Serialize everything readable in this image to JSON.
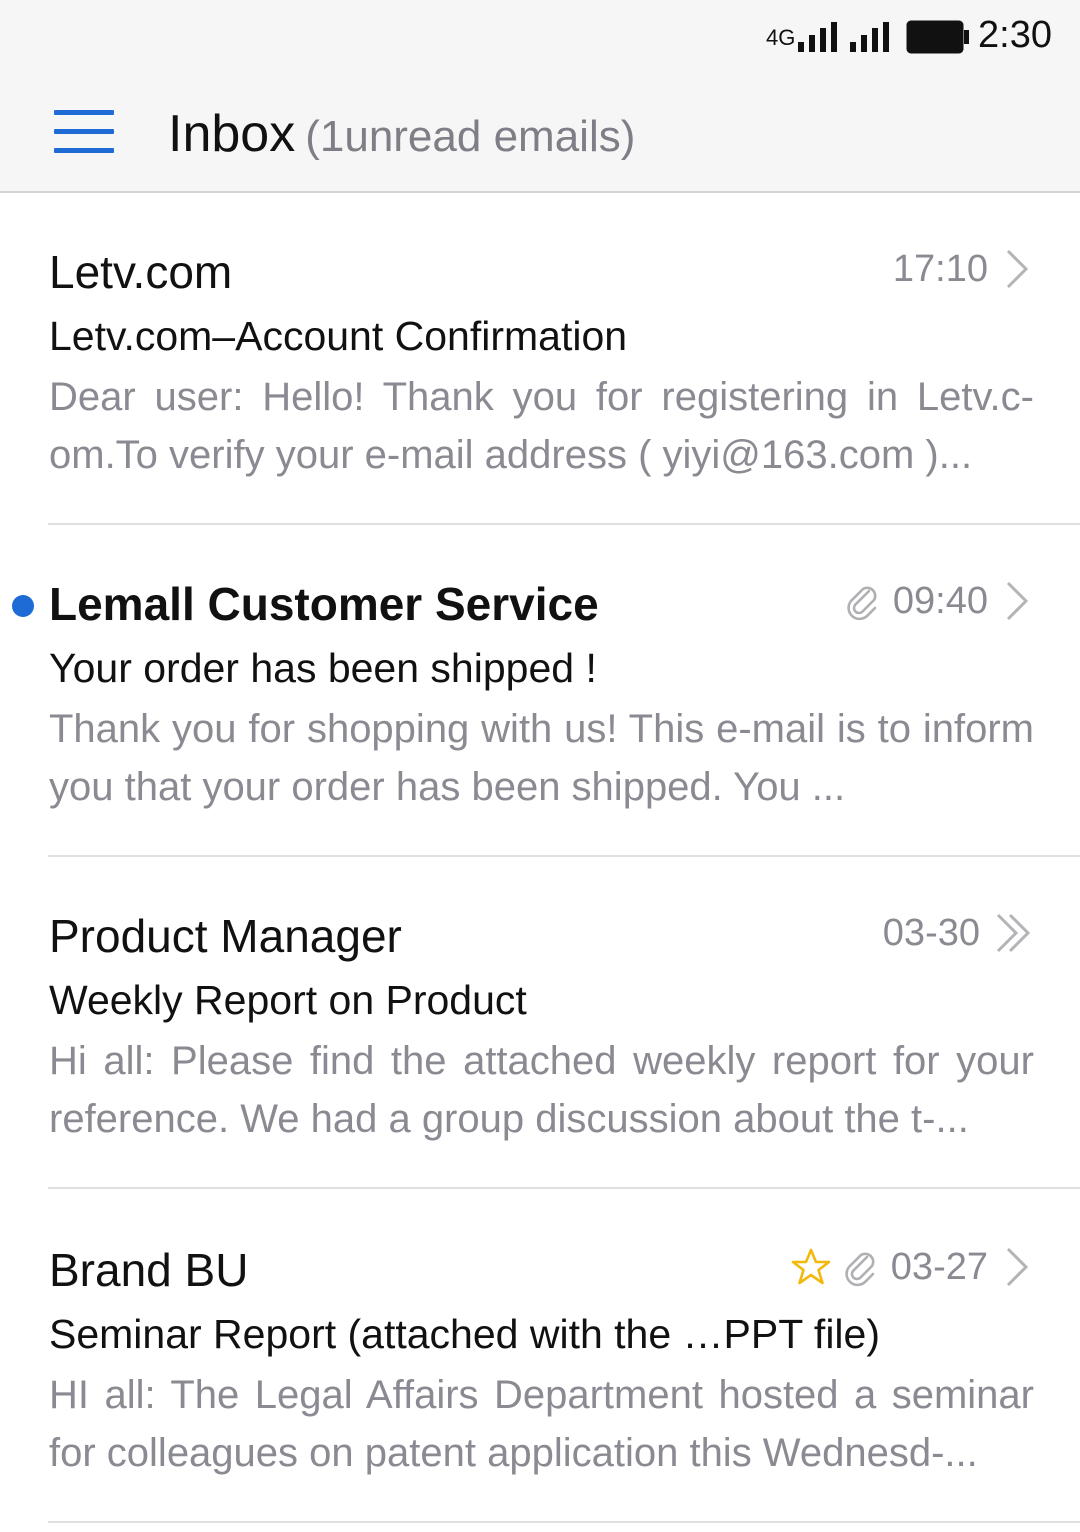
{
  "status_bar": {
    "network": "4G",
    "time": "2:30",
    "icons": [
      "signal-icon",
      "signal-icon",
      "battery-icon"
    ]
  },
  "header": {
    "title": "Inbox",
    "unread_text": "(1unread emails)",
    "menu_icon": "hamburger-menu-icon",
    "accent_color": "#1e6bd6"
  },
  "emails": [
    {
      "sender": "Letv.com",
      "subject": "Letv.com–Account Confirmation",
      "preview": "Dear user: Hello! Thank you for registering in Letv.c-om.To verify your e-mail address ( yiyi@163.com )...",
      "time": "17:10",
      "unread": false,
      "attachment": false,
      "starred": false,
      "chevron": "chevron-right-icon"
    },
    {
      "sender": "Lemall Customer Service",
      "subject": "Your order has been shipped !",
      "preview": "Thank you for shopping with us! This e-mail is to inform you that your order has been shipped. You ...",
      "time": "09:40",
      "unread": true,
      "attachment": true,
      "starred": false,
      "chevron": "chevron-right-icon"
    },
    {
      "sender": "Product Manager",
      "subject": "Weekly Report on Product",
      "preview": "Hi all: Please find the attached weekly report for your reference. We had a group discussion about the t-...",
      "time": "03-30",
      "unread": false,
      "attachment": false,
      "starred": false,
      "chevron": "double-chevron-right-icon"
    },
    {
      "sender": "Brand BU",
      "subject": "Seminar Report (attached with the …PPT file)",
      "preview": "HI all: The Legal Affairs Department hosted a seminar for colleagues on patent application this Wednesd-...",
      "time": "03-27",
      "unread": false,
      "attachment": true,
      "starred": true,
      "chevron": "chevron-right-icon"
    }
  ]
}
